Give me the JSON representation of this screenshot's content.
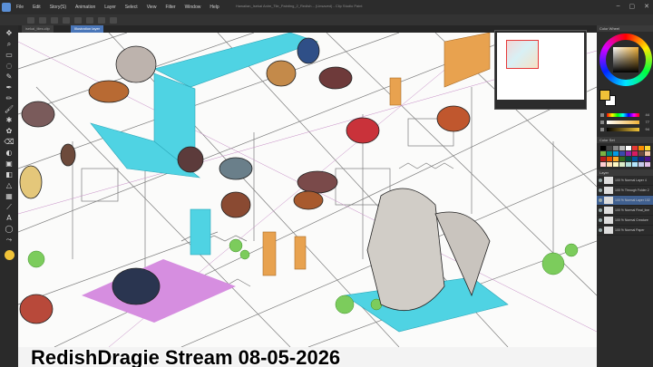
{
  "window": {
    "title": "Hawaiian_Isekai Anim_Tile_Painting_2_Redish... (Unsaved) - Clip Studio Paint"
  },
  "menu": {
    "items": [
      "File",
      "Edit",
      "Story(S)",
      "Animation",
      "Layer",
      "Select",
      "View",
      "Filter",
      "Window",
      "Help"
    ]
  },
  "tabs": [
    {
      "label": "isekai_tiles.clip"
    },
    {
      "label": "Illustration layer"
    }
  ],
  "tools": [
    "move-tool",
    "zoom-tool",
    "select-tool",
    "lasso-tool",
    "eyedropper-tool",
    "pen-tool",
    "pencil-tool",
    "brush-tool",
    "airbrush-tool",
    "decoration-tool",
    "eraser-tool",
    "blend-tool",
    "fill-tool",
    "gradient-tool",
    "figure-tool",
    "frame-tool",
    "ruler-tool",
    "text-tool",
    "balloon-tool",
    "correct-line-tool"
  ],
  "tool_glyphs": [
    "✥",
    "⌕",
    "▭",
    "◌",
    "✎",
    "✒",
    "✏",
    "🖌",
    "✱",
    "✿",
    "⌫",
    "◐",
    "▣",
    "◧",
    "△",
    "▦",
    "⟋",
    "A",
    "◯",
    "⤳"
  ],
  "color_panel": {
    "header": "Color Wheel",
    "main_color": "#f0c238",
    "sub_color": "#ffffff",
    "sliders": [
      {
        "label": "H",
        "value": "44"
      },
      {
        "label": "S",
        "value": "77"
      },
      {
        "label": "V",
        "value": "94"
      }
    ]
  },
  "palette_header": "Color Set",
  "palette_colors": [
    "#000000",
    "#444444",
    "#888888",
    "#bbbbbb",
    "#ffffff",
    "#e53935",
    "#fb8c00",
    "#fdd835",
    "#7cb342",
    "#00897b",
    "#039be5",
    "#3949ab",
    "#8e24aa",
    "#d81b60",
    "#6d4c41",
    "#f4c7a5",
    "#b71c1c",
    "#e65100",
    "#f9a825",
    "#33691e",
    "#004d40",
    "#01579b",
    "#1a237e",
    "#4a148c",
    "#ffcdd2",
    "#ffe0b2",
    "#fff9c4",
    "#dcedc8",
    "#b2dfdb",
    "#b3e5fc",
    "#c5cae9",
    "#e1bee7"
  ],
  "layers_header": "Layer",
  "layers": [
    {
      "name": "100 % Normal Layer 4"
    },
    {
      "name": "100 % Through Folder 2"
    },
    {
      "name": "100 % Normal Layer 102"
    },
    {
      "name": "100 % Normal Final_line"
    },
    {
      "name": "100 % Normal Creature"
    },
    {
      "name": "100 % Normal Paper"
    }
  ],
  "caption": {
    "text": "RedishDragie Stream 08-05-2026"
  }
}
